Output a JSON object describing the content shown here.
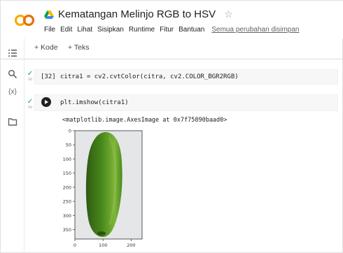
{
  "header": {
    "logo_text": "CO",
    "title": "Kematangan Melinjo RGB to HSV",
    "star_icon": "star-outline-icon",
    "menu": [
      "File",
      "Edit",
      "Lihat",
      "Sisipkan",
      "Runtime",
      "Fitur",
      "Bantuan"
    ],
    "saved_status": "Semua perubahan disimpan"
  },
  "toolbar": {
    "add_code": "+ Kode",
    "add_text": "+ Teks"
  },
  "rail": {
    "icons": [
      "table-of-contents-icon",
      "search-icon",
      "variables-icon",
      "folder-icon"
    ],
    "variables_label": "{x}"
  },
  "cells": [
    {
      "execution_count": "[32]",
      "code": "citra1 = cv2.cvtColor(citra, cv2.COLOR_BGR2RGB)",
      "status": "✓",
      "time": "0d"
    },
    {
      "code": "plt.imshow(citra1)",
      "status": "✓",
      "time": "0d",
      "output": "<matplotlib.image.AxesImage at 0x7f75890baad0>"
    }
  ],
  "chart_data": {
    "type": "image",
    "y_ticks": [
      "0",
      "50",
      "100",
      "150",
      "200",
      "250",
      "300",
      "350"
    ],
    "x_ticks": [
      "0",
      "100",
      "200"
    ],
    "colors": {
      "fruit_dark": "#2f5a12",
      "fruit_mid": "#4a8a1c",
      "fruit_light": "#7fb53a",
      "background": "#e4e6e8"
    }
  }
}
